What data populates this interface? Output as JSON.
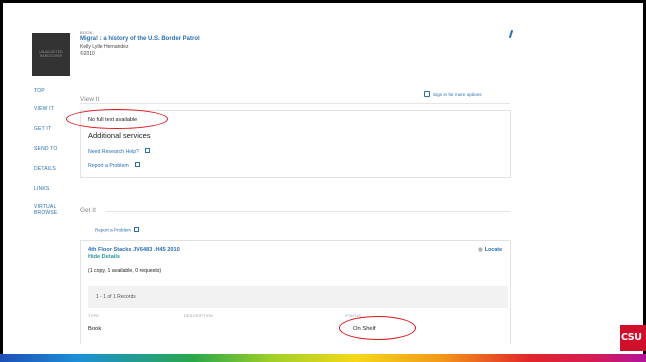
{
  "record": {
    "cover_text": "UNJACKETED HARDCOVER",
    "type": "BOOK",
    "title": "Migra! : a history of the U.S. Border Patrol",
    "author": "Kelly Lytle Hernandez",
    "date": "©2010"
  },
  "sidebar": {
    "items": [
      {
        "label": "TOP"
      },
      {
        "label": "VIEW IT"
      },
      {
        "label": "GET IT"
      },
      {
        "label": "SEND TO"
      },
      {
        "label": "DETAILS"
      },
      {
        "label": "LINKS"
      },
      {
        "label": "VIRTUAL BROWSE"
      }
    ]
  },
  "view_it": {
    "heading": "View It",
    "sign_in": "Sign in for more options",
    "no_fulltext": "No full text available",
    "additional_services": "Additional services",
    "research_help": "Need Research Help?",
    "report_problem": "Report a Problem"
  },
  "get_it": {
    "heading": "Get It",
    "report_problem": "Report a Problem",
    "location": "4th Floor Stacks  JV6483 .H45 2010",
    "hide_details": "Hide Details",
    "locate": "Locate",
    "copies": "(1 copy, 1 available, 0 requests)",
    "records": "1 - 1 of 1 Records",
    "columns": [
      "TYPE",
      "DESCRIPTION",
      "STATUS"
    ],
    "row": {
      "type": "Book",
      "description": "",
      "status": "On Shelf"
    }
  },
  "branding": {
    "logo_text": "CSU"
  },
  "colors": {
    "link": "#2a6fb0",
    "highlight": "#e0161b",
    "logo": "#d0102b"
  },
  "icons": [
    "pin-icon",
    "sign-in-icon",
    "external-link-icon",
    "map-marker-icon"
  ]
}
